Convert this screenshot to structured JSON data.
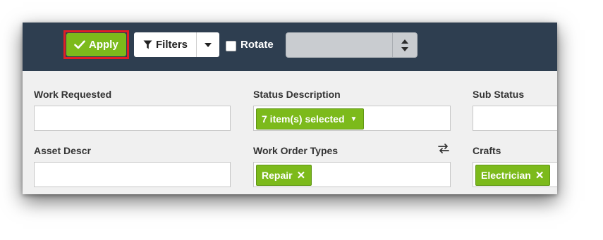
{
  "toolbar": {
    "apply_label": "Apply",
    "filters_label": "Filters",
    "rotate_label": "Rotate",
    "rotate_checked": false,
    "spin_value": ""
  },
  "fields": {
    "work_requested": {
      "label": "Work Requested",
      "value": ""
    },
    "status_description": {
      "label": "Status Description",
      "selected_text": "7 item(s) selected"
    },
    "sub_status": {
      "label": "Sub Status",
      "value": ""
    },
    "asset_descr": {
      "label": "Asset Descr",
      "value": ""
    },
    "work_order_types": {
      "label": "Work Order Types",
      "chip": "Repair"
    },
    "crafts": {
      "label": "Crafts",
      "chip": "Electrician"
    }
  },
  "icons": {
    "apply": "check-icon",
    "filters": "funnel-icon",
    "filters_dropdown": "caret-down-icon",
    "spin_up": "caret-up-icon",
    "spin_down": "caret-down-icon",
    "swap": "swap-arrows-icon",
    "chip_remove": "x-icon"
  },
  "colors": {
    "toolbar_bg": "#2e3e50",
    "accent_green": "#7cba1b",
    "highlight_red": "#e11e26",
    "panel_bg": "#f0f0f0"
  }
}
